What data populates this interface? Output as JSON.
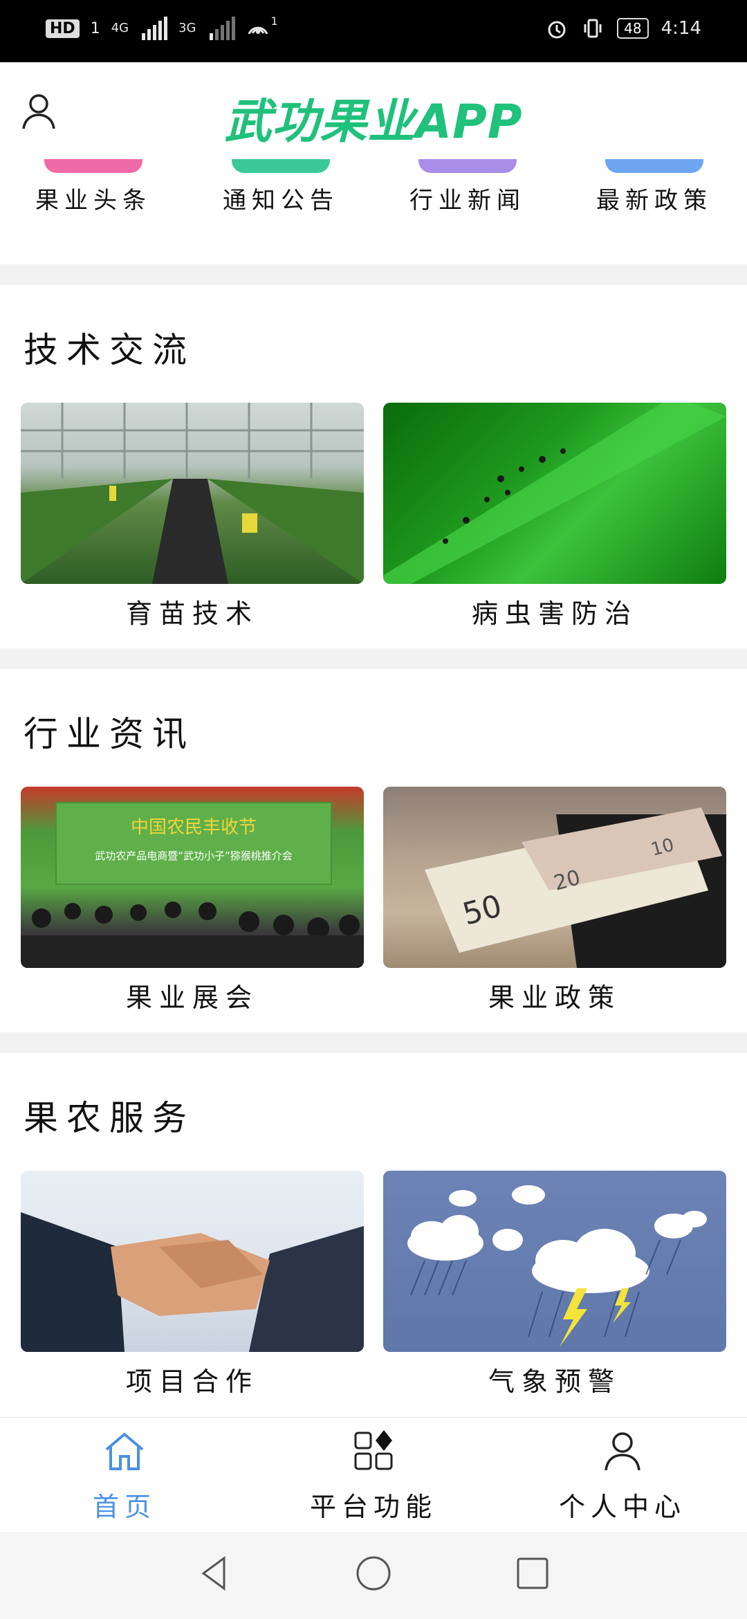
{
  "status_bar": {
    "hd": "HD",
    "hd_sub": "1",
    "net1": "4G",
    "net2": "3G",
    "hotspot_count": "1",
    "battery": "48",
    "time": "4:14"
  },
  "header": {
    "title": "武功果业APP"
  },
  "categories": [
    {
      "label": "果业头条",
      "color": "#f06aa8"
    },
    {
      "label": "通知公告",
      "color": "#3cc99a"
    },
    {
      "label": "行业新闻",
      "color": "#a98de8"
    },
    {
      "label": "最新政策",
      "color": "#6fa6f2"
    }
  ],
  "sections": [
    {
      "title": "技术交流",
      "cards": [
        {
          "label": "育苗技术"
        },
        {
          "label": "病虫害防治"
        }
      ]
    },
    {
      "title": "行业资讯",
      "cards": [
        {
          "label": "果业展会"
        },
        {
          "label": "果业政策"
        }
      ],
      "banner_text": "中国农民丰收节",
      "banner_sub": "武功农产品电商暨“武功小子”猕猴桃推介会"
    },
    {
      "title": "果农服务",
      "cards": [
        {
          "label": "项目合作"
        },
        {
          "label": "气象预警"
        }
      ]
    }
  ],
  "wallet_notes": [
    "50",
    "20",
    "10"
  ],
  "bottom_nav": [
    {
      "label": "首页",
      "active": true
    },
    {
      "label": "平台功能",
      "active": false
    },
    {
      "label": "个人中心",
      "active": false
    }
  ],
  "colors": {
    "accent": "#1fc17b",
    "nav_active": "#4a90e2"
  }
}
